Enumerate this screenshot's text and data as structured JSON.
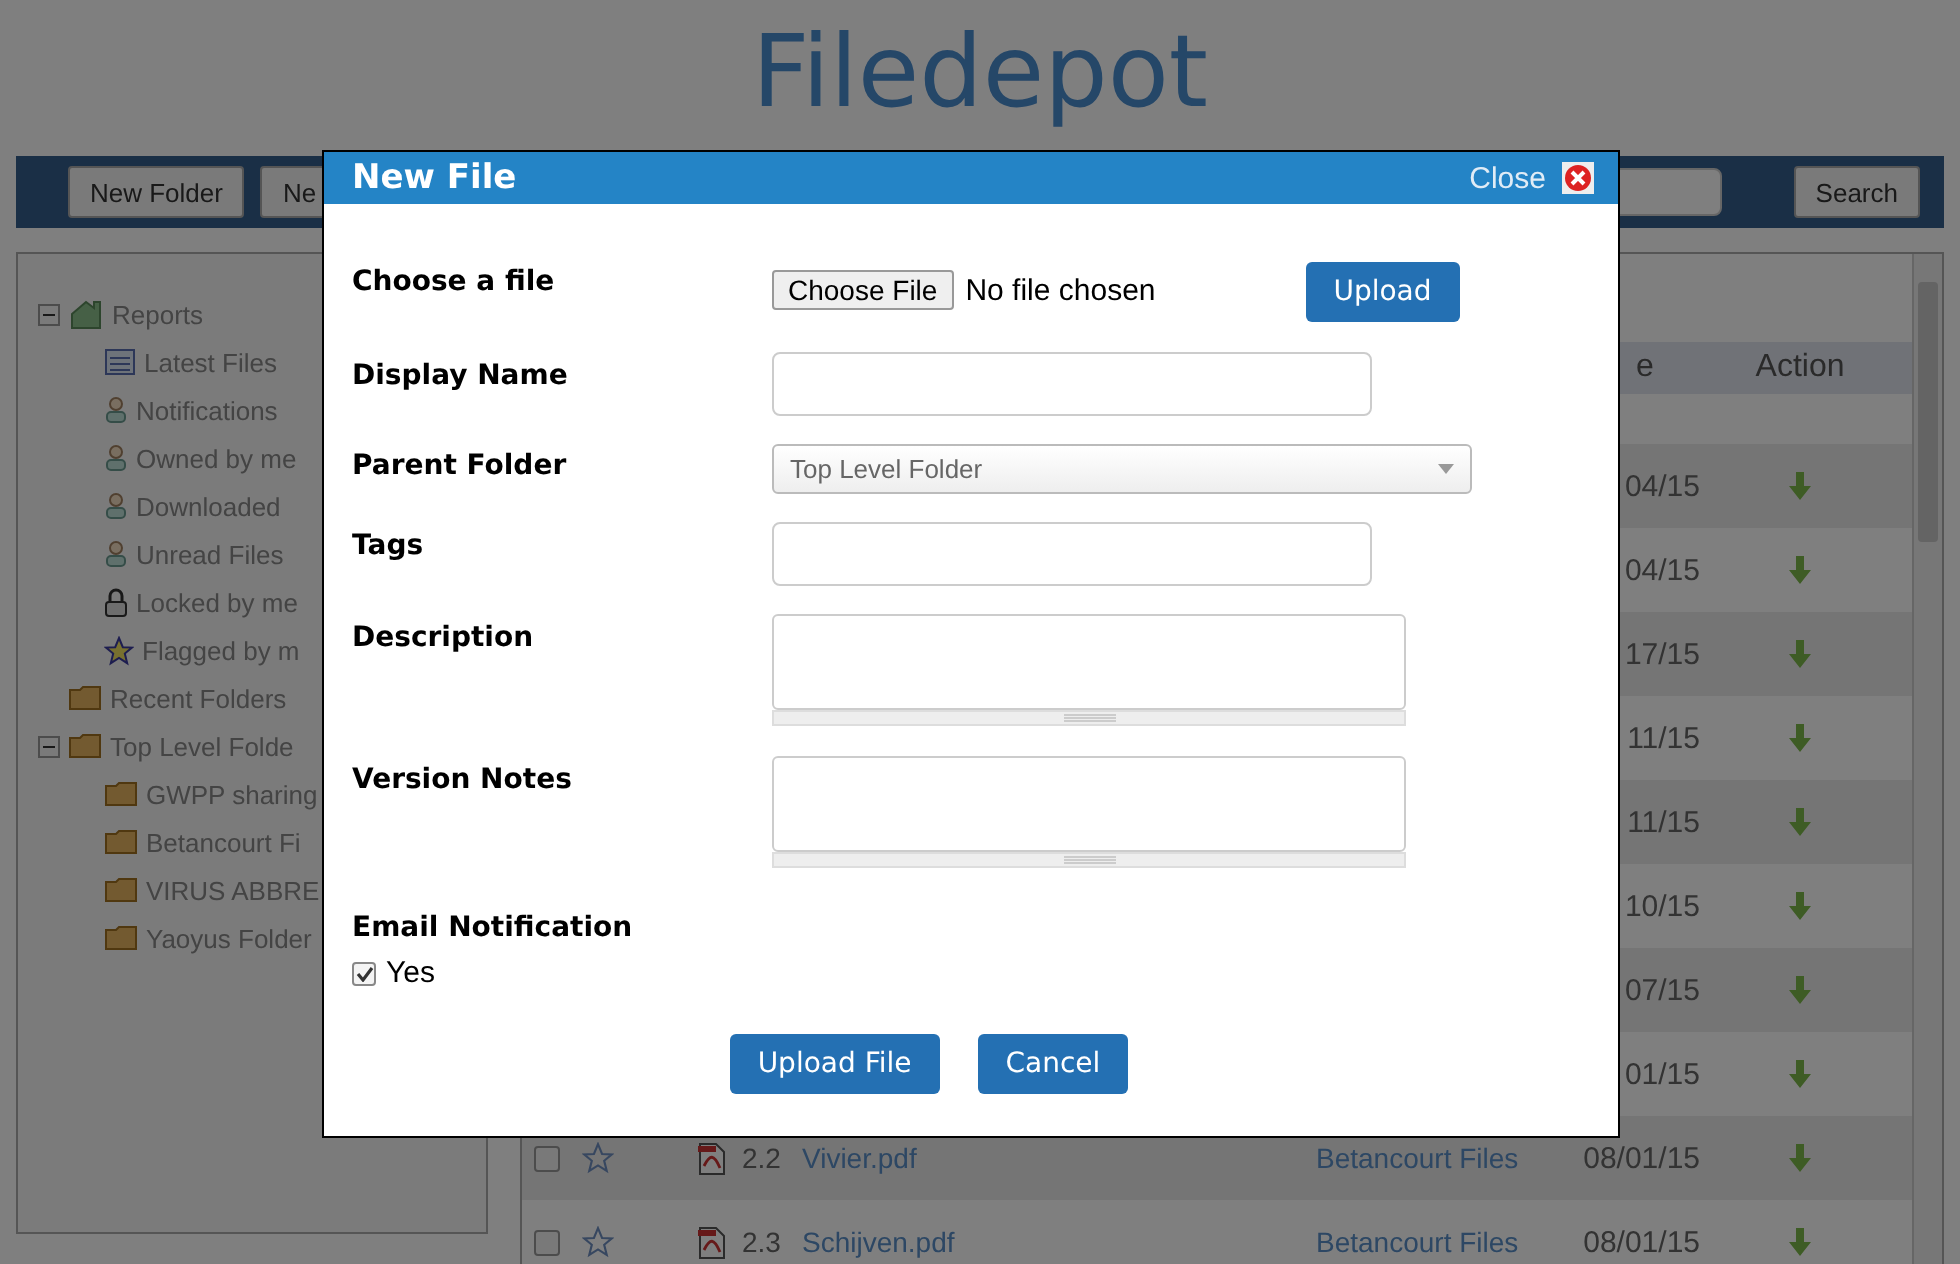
{
  "page_title": "Filedepot",
  "toolbar": {
    "buttons": [
      "New Folder",
      "Ne"
    ],
    "search_button": "Search"
  },
  "tree": [
    {
      "label": "Reports",
      "kind": "home",
      "expanded": true,
      "children": [
        {
          "label": "Latest Files",
          "kind": "list"
        },
        {
          "label": "Notifications",
          "kind": "user"
        },
        {
          "label": "Owned by me",
          "kind": "user"
        },
        {
          "label": "Downloaded",
          "kind": "user"
        },
        {
          "label": "Unread Files",
          "kind": "user"
        },
        {
          "label": "Locked by me",
          "kind": "lock"
        },
        {
          "label": "Flagged by m",
          "kind": "star"
        }
      ]
    },
    {
      "label": "Recent Folders",
      "kind": "folder"
    },
    {
      "label": "Top Level Folde",
      "kind": "folder",
      "expanded": true,
      "children": [
        {
          "label": "GWPP sharing",
          "kind": "folder"
        },
        {
          "label": "Betancourt Fi",
          "kind": "folder"
        },
        {
          "label": "VIRUS ABBRE",
          "kind": "folder"
        },
        {
          "label": "Yaoyus Folder",
          "kind": "folder"
        }
      ]
    }
  ],
  "table": {
    "columns": [
      "e",
      "Action"
    ],
    "rows": [
      {
        "date": "04/15"
      },
      {
        "date": "04/15"
      },
      {
        "date": "17/15"
      },
      {
        "date": "11/15"
      },
      {
        "date": "11/15"
      },
      {
        "date": "10/15"
      },
      {
        "date": "07/15"
      },
      {
        "date": "01/15"
      },
      {
        "checked": false,
        "flagged": false,
        "number": "2.2",
        "name": "Vivier.pdf",
        "folder": "Betancourt Files",
        "date": "08/01/15"
      },
      {
        "checked": false,
        "flagged": false,
        "number": "2.3",
        "name": "Schijven.pdf",
        "folder": "Betancourt Files",
        "date": "08/01/15"
      }
    ]
  },
  "dialog": {
    "title": "New File",
    "close": "Close",
    "fields": [
      {
        "kind": "file",
        "label": "Choose a file",
        "button": "Choose File",
        "status": "No file chosen",
        "action": "Upload"
      },
      {
        "kind": "text",
        "label": "Display Name"
      },
      {
        "kind": "select",
        "label": "Parent Folder",
        "value": "Top Level Folder"
      },
      {
        "kind": "text",
        "label": "Tags"
      },
      {
        "kind": "textarea",
        "label": "Description"
      },
      {
        "kind": "textarea",
        "label": "Version Notes"
      },
      {
        "kind": "checkbox",
        "label": "Email Notification",
        "option": "Yes",
        "checked": true
      }
    ],
    "buttons": [
      "Upload File",
      "Cancel"
    ]
  }
}
